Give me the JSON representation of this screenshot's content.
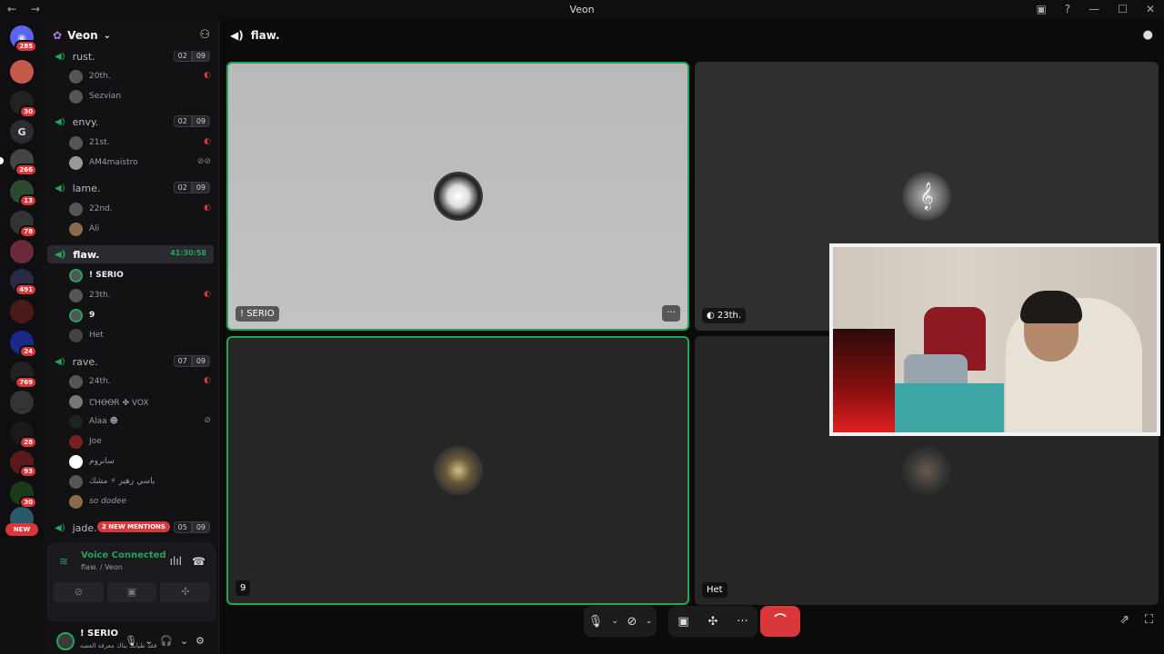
{
  "window": {
    "title": "Veon",
    "nav": "← →",
    "icons": [
      "inbox-icon",
      "help-icon",
      "minimize-icon",
      "maximize-icon",
      "close-icon"
    ],
    "icon_glyphs": [
      "▣",
      "?",
      "—",
      "☐",
      "✕"
    ]
  },
  "servers": {
    "badges": [
      "285",
      "30",
      "266",
      "13",
      "78",
      "491",
      "24",
      "769",
      "28",
      "93",
      "30"
    ],
    "new_label": "NEW",
    "letter": "G"
  },
  "guild": {
    "name": "Veon",
    "chevron": "⌄"
  },
  "channels": [
    {
      "name": "rust.",
      "count_a": "02",
      "count_b": "09",
      "users": [
        {
          "name": "20th.",
          "icon": "deafened"
        },
        {
          "name": "Sezvian"
        }
      ]
    },
    {
      "name": "envy.",
      "count_a": "02",
      "count_b": "09",
      "users": [
        {
          "name": "21st.",
          "icon": "deafened"
        },
        {
          "name": "AM4maistro",
          "icon": "muted"
        }
      ]
    },
    {
      "name": "lame.",
      "count_a": "02",
      "count_b": "09",
      "users": [
        {
          "name": "22nd.",
          "icon": "deafened"
        },
        {
          "name": "Ali"
        }
      ]
    },
    {
      "name": "flaw.",
      "timer": "41:30:58",
      "active": true,
      "users": [
        {
          "name": "! SERIO",
          "bold": true
        },
        {
          "name": "23th.",
          "icon": "deafened"
        },
        {
          "name": "9",
          "bold": true
        },
        {
          "name": "Het"
        }
      ]
    },
    {
      "name": "rave.",
      "count_a": "07",
      "count_b": "09",
      "users": [
        {
          "name": "24th.",
          "icon": "deafened"
        },
        {
          "name": "ꞆꞪꝊꝊɌ ✤ VOX"
        },
        {
          "name": "Alaa ☻",
          "icon": "muted"
        },
        {
          "name": "Joe"
        },
        {
          "name": "سانروم"
        },
        {
          "name": "ياسي زهير ⚡ مشك"
        },
        {
          "name": "so dodee"
        }
      ]
    },
    {
      "name": "jade.",
      "count_a": "05",
      "count_b": "09",
      "mention": "2 NEW MENTIONS"
    }
  ],
  "voice": {
    "status": "Voice Connected",
    "location": "flaw. / Veon"
  },
  "user": {
    "name": "! SERIO",
    "status": "فقد طيابك يناك معرفة الغضه"
  },
  "call": {
    "channel": "flaw.",
    "tiles": [
      {
        "label": "! SERIO",
        "speaking": true
      },
      {
        "label": "23th.",
        "icon": "deafened"
      },
      {
        "label": "9",
        "speaking": true
      },
      {
        "label": "Het"
      }
    ],
    "more_label": "···"
  },
  "controls": {
    "leave_label": "⌒"
  }
}
